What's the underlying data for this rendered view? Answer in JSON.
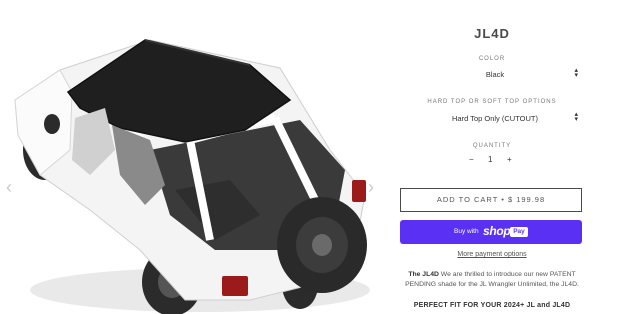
{
  "product": {
    "title": "JL4D"
  },
  "options": {
    "color": {
      "label": "COLOR",
      "value": "Black"
    },
    "top": {
      "label": "HARD TOP OR SOFT TOP OPTIONS",
      "value": "Hard Top Only (CUTOUT)"
    },
    "quantity": {
      "label": "QUANTITY",
      "minus": "−",
      "value": "1",
      "plus": "+"
    }
  },
  "actions": {
    "add_to_cart": "ADD TO CART • $ 199.98",
    "buy_with": "Buy with",
    "shop_brand": "shop",
    "shop_pay": "Pay",
    "more_payment": "More payment options"
  },
  "description": {
    "lead": "The JL4D",
    "text": " We are thrilled to introduce our new PATENT PENDING shade for the JL Wrangler Unlimited, the JL4D.",
    "fit_heading": "PERFECT FIT FOR YOUR 2024+ JL and JL4D"
  },
  "gallery": {
    "prev_icon": "‹",
    "next_icon": "›"
  }
}
